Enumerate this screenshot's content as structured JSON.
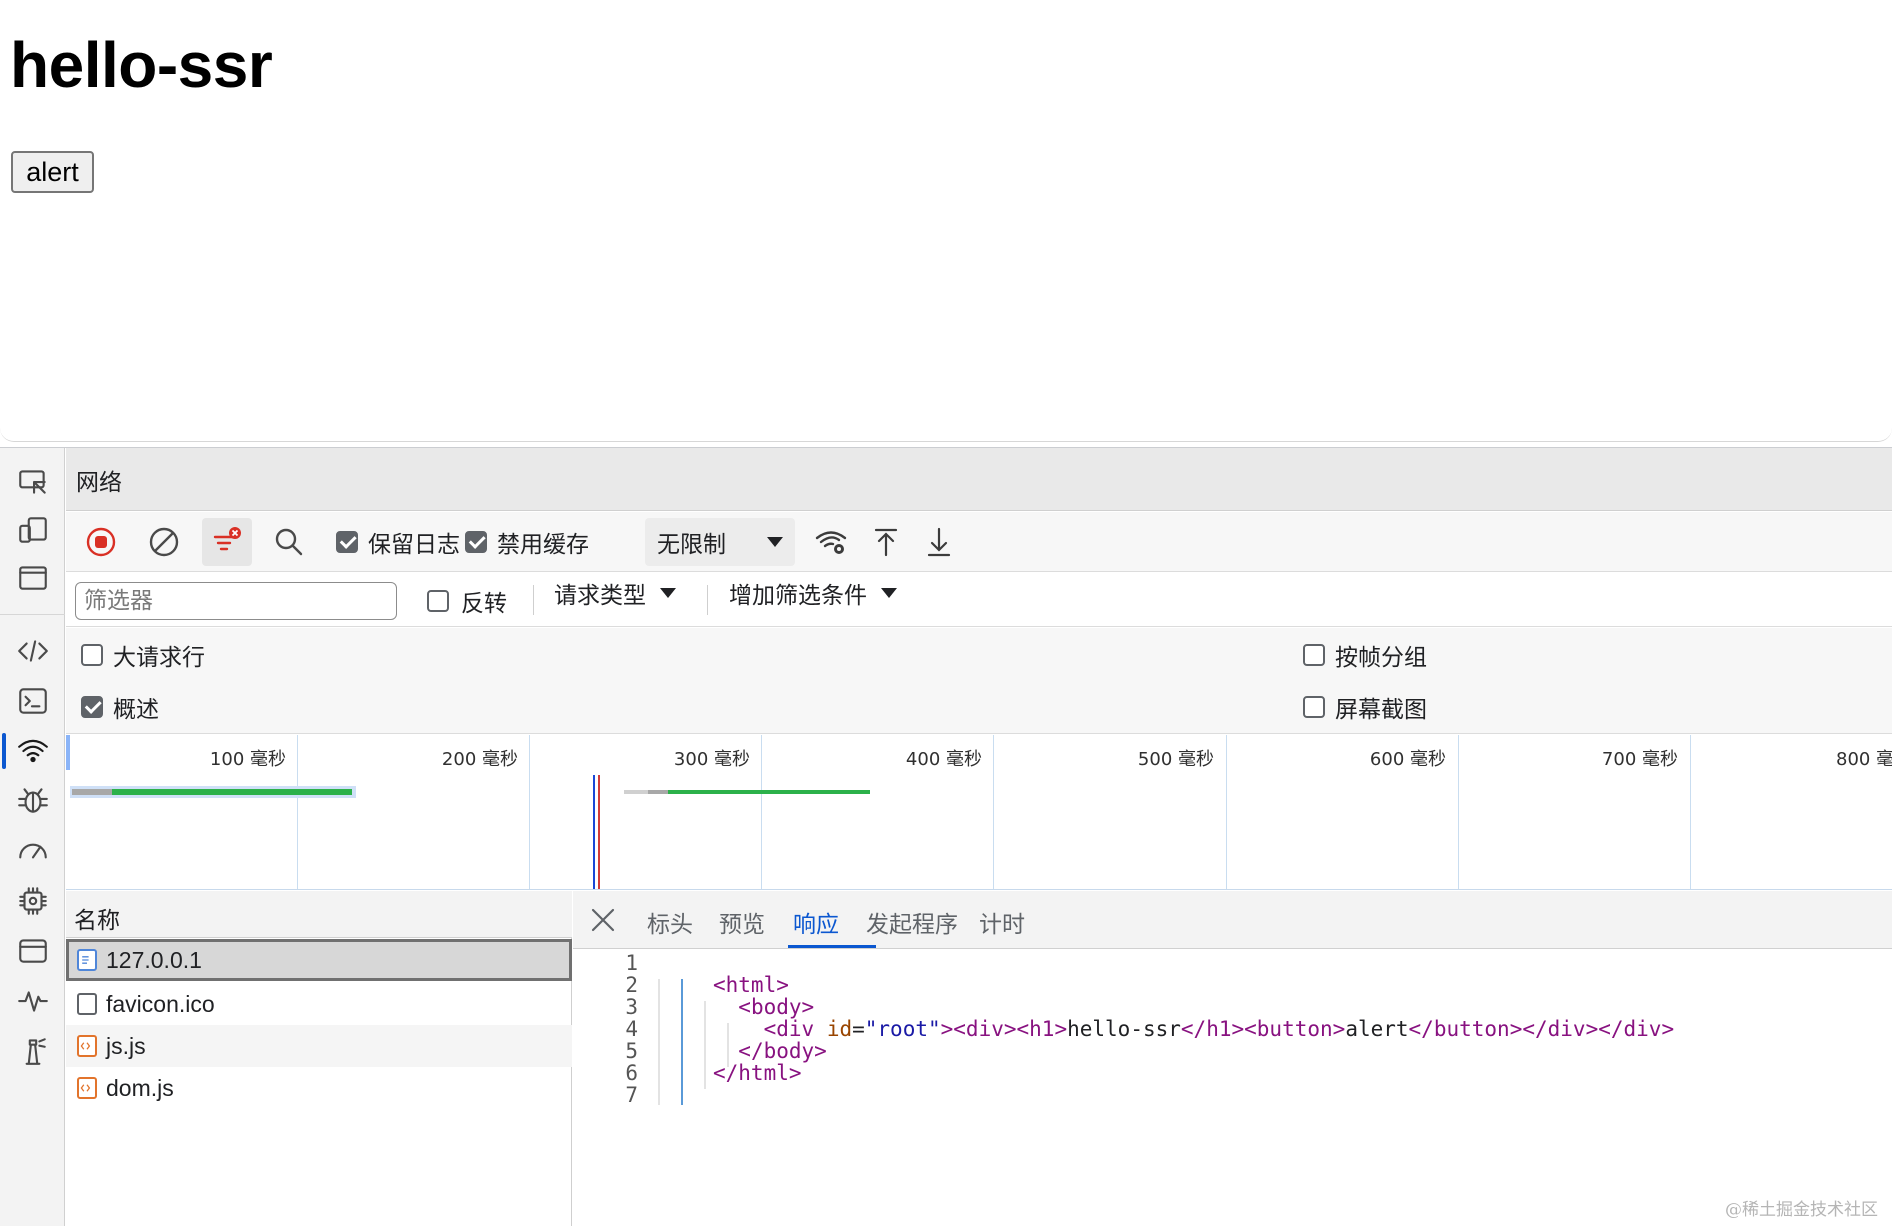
{
  "page_preview": {
    "heading": "hello-ssr",
    "button_label": "alert"
  },
  "devtools": {
    "panel_title": "网络",
    "toolbar": {
      "preserve_log_label": "保留日志",
      "preserve_log_checked": true,
      "disable_cache_label": "禁用缓存",
      "disable_cache_checked": true,
      "throttling_value": "无限制"
    },
    "filter_bar": {
      "filter_placeholder": "筛选器",
      "invert_label": "反转",
      "request_type_label": "请求类型",
      "more_filters_label": "增加筛选条件"
    },
    "settings": {
      "big_request_rows_label": "大请求行",
      "big_request_rows_checked": false,
      "overview_label": "概述",
      "overview_checked": true,
      "group_by_frame_label": "按帧分组",
      "group_by_frame_checked": false,
      "screenshots_label": "屏幕截图",
      "screenshots_checked": false
    },
    "overview": {
      "ticks": [
        "100 毫秒",
        "200 毫秒",
        "300 毫秒",
        "400 毫秒",
        "500 毫秒",
        "600 毫秒",
        "700 毫秒",
        "800 毫秒"
      ],
      "colors": {
        "waiting": "#a8a8a8",
        "download": "#2cb14a",
        "dom_content_loaded": "#1a47d6",
        "load": "#d23a3a"
      }
    },
    "request_list": {
      "header": "名称",
      "items": [
        {
          "name": "127.0.0.1",
          "type_icon": "document-icon",
          "selected": true
        },
        {
          "name": "favicon.ico",
          "type_icon": "blank-file-icon",
          "selected": false
        },
        {
          "name": "js.js",
          "type_icon": "script-icon",
          "selected": false
        },
        {
          "name": "dom.js",
          "type_icon": "script-icon",
          "selected": false
        }
      ]
    },
    "detail": {
      "tabs": [
        "标头",
        "预览",
        "响应",
        "发起程序",
        "计时"
      ],
      "active_tab": "响应",
      "line_numbers": [
        "1",
        "2",
        "3",
        "4",
        "5",
        "6",
        "7"
      ],
      "code_lines": [
        "",
        "<html>",
        "  <body>",
        "    <div id=\"root\"><div><h1>hello-ssr</h1><button>alert</button></div></div>",
        "  </body>",
        "</html>",
        ""
      ]
    },
    "activity_icons": [
      "inspect-icon",
      "device-toolbar-icon",
      "window-icon",
      "elements-icon",
      "console-icon",
      "network-icon",
      "sources-icon",
      "performance-icon",
      "memory-icon",
      "application-icon",
      "activity-icon",
      "lighthouse-icon"
    ]
  },
  "watermark": "@稀土掘金技术社区"
}
